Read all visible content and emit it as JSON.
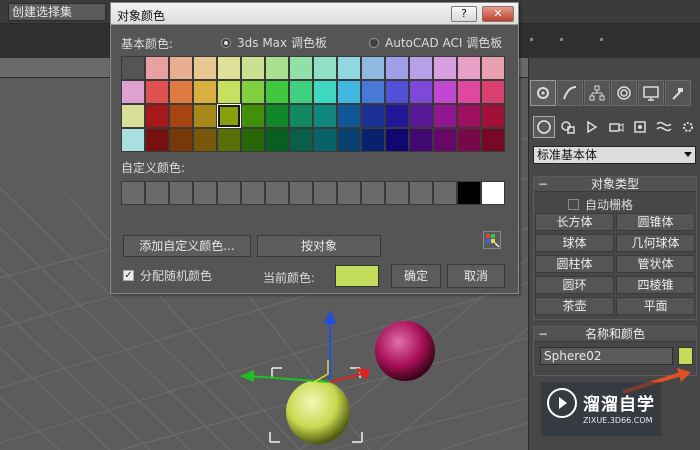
{
  "main": {
    "selection_set": "创建选择集"
  },
  "dialog": {
    "title": "对象颜色",
    "help_label": "?",
    "close_label": "✕",
    "basic_colors_label": "基本颜色:",
    "palette_options": [
      "3ds Max 调色板",
      "AutoCAD ACI 调色板"
    ],
    "selected_palette": "3ds Max 调色板",
    "basic_colors": [
      [
        "#555555",
        "#e8a0a0",
        "#e8b090",
        "#e8c890",
        "#e0e098",
        "#c8e090",
        "#a8e090",
        "#90e0a8",
        "#90e0c8",
        "#90d8e0",
        "#90b8e0",
        "#a0a0e8",
        "#b8a0e8",
        "#d8a0e0",
        "#e8a0c8",
        "#e8a0b0"
      ],
      [
        "#e0a0d0",
        "#e05050",
        "#e07a40",
        "#d8b040",
        "#c8e060",
        "#80d040",
        "#40c840",
        "#40d080",
        "#40d8c0",
        "#40b8e0",
        "#4878d8",
        "#5050d8",
        "#8048d8",
        "#c048d0",
        "#e048a0",
        "#d84070"
      ],
      [
        "#d8e098",
        "#a81818",
        "#a84410",
        "#a88818",
        "#88a010",
        "#40900c",
        "#108828",
        "#108860",
        "#108880",
        "#105898",
        "#183098",
        "#201898",
        "#581898",
        "#901890",
        "#a01060",
        "#a01038"
      ],
      [
        "#a8e0e0",
        "#781010",
        "#783808",
        "#785808",
        "#587008",
        "#286808",
        "#086020",
        "#086048",
        "#086068",
        "#084070",
        "#082070",
        "#100870",
        "#400870",
        "#680868",
        "#780848",
        "#780828"
      ]
    ],
    "selected_swatch": "2-4",
    "custom_colors_label": "自定义颜色:",
    "custom_colors": [
      "#6a6a6a",
      "#6a6a6a",
      "#6a6a6a",
      "#6a6a6a",
      "#6a6a6a",
      "#6a6a6a",
      "#6a6a6a",
      "#6a6a6a",
      "#6a6a6a",
      "#6a6a6a",
      "#6a6a6a",
      "#6a6a6a",
      "#6a6a6a",
      "#6a6a6a",
      "#000000",
      "#ffffff"
    ],
    "add_custom_label": "添加自定义颜色...",
    "by_object_label": "按对象",
    "random_colors_label": "分配随机颜色",
    "random_colors_checked": true,
    "current_color_label": "当前颜色:",
    "current_color": "#c4dc5c",
    "ok_label": "确定",
    "cancel_label": "取消"
  },
  "command_panel": {
    "object_category": "标准基本体",
    "object_type_header": "对象类型",
    "autogrid_label": "自动栅格",
    "primitives": [
      "长方体",
      "圆锥体",
      "球体",
      "几何球体",
      "圆柱体",
      "管状体",
      "圆环",
      "四棱锥",
      "茶壶",
      "平面"
    ],
    "name_color_header": "名称和颜色",
    "object_name": "Sphere02",
    "object_color": "#c4dc5c"
  },
  "watermark": {
    "brand": "溜溜自学",
    "url": "ZIXUE.3D66.COM"
  }
}
